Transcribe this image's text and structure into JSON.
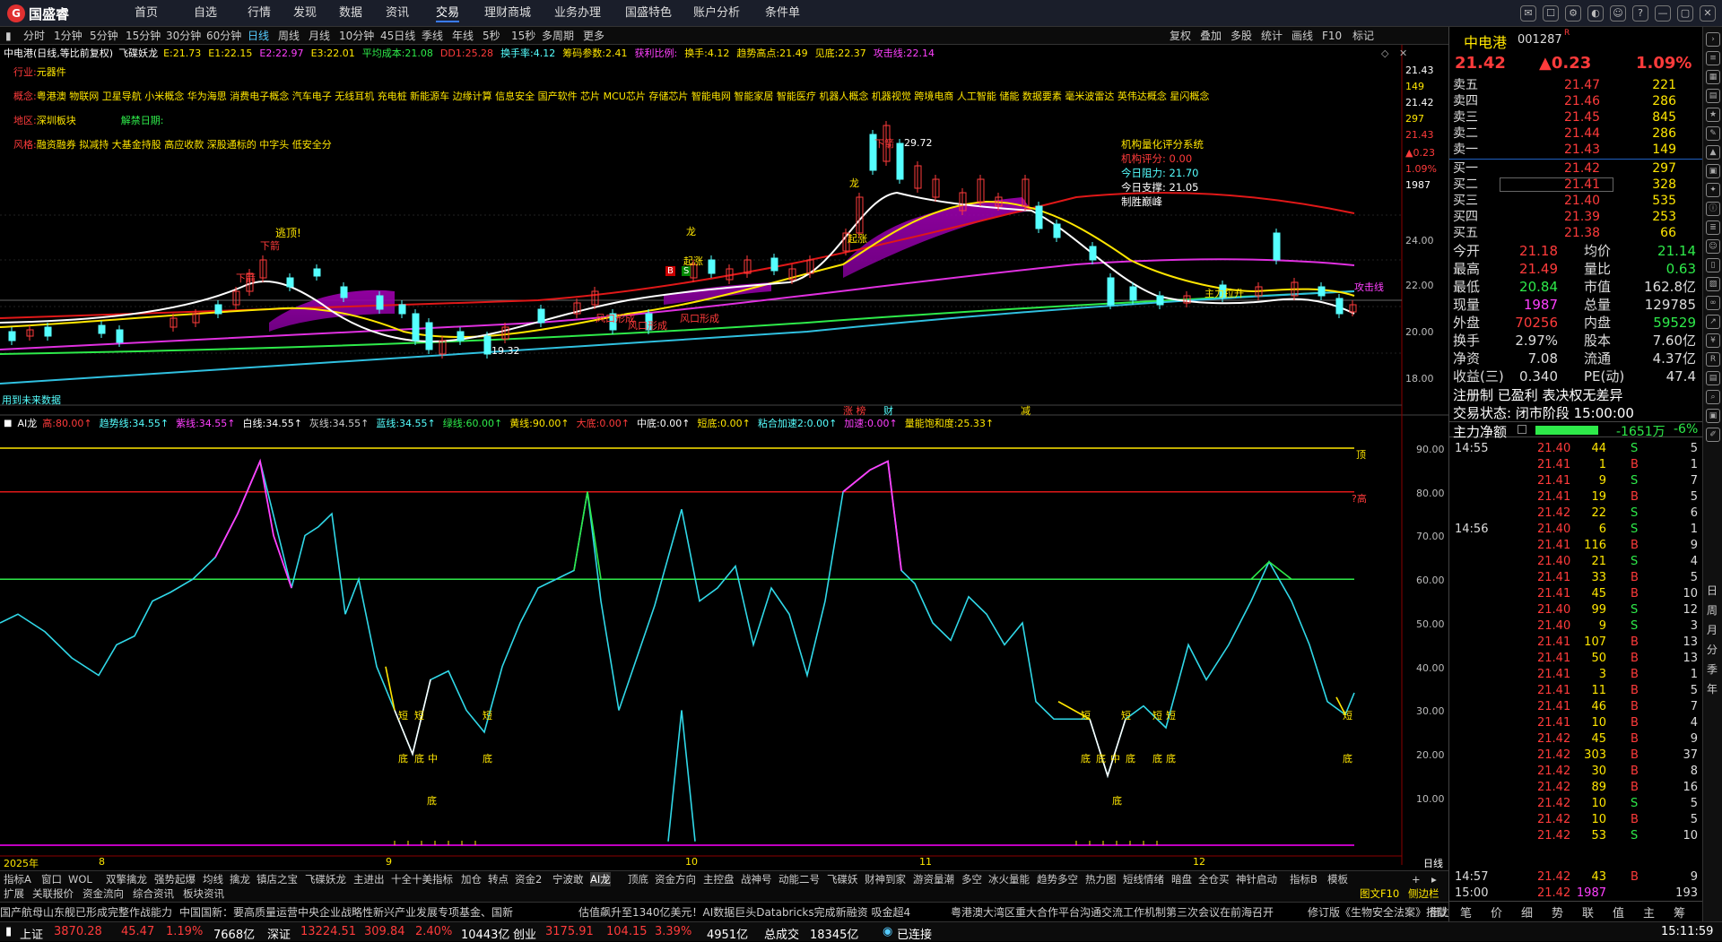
{
  "app": {
    "logo": "国盛睿",
    "logo_mark": "G"
  },
  "menu": [
    "首页",
    "自选",
    "行情",
    "发现",
    "数据",
    "资讯",
    "交易",
    "理财商城",
    "业务办理",
    "国盛特色",
    "账户分析",
    "条件单"
  ],
  "menu_active": 6,
  "window_buttons": [
    "消息",
    "消息2",
    "设置",
    "皮肤",
    "客服",
    "帮助",
    "最小化",
    "最大化",
    "关闭"
  ],
  "timeframes": [
    "分时",
    "1分钟",
    "5分钟",
    "15分钟",
    "30分钟",
    "60分钟",
    "日线",
    "周线",
    "月线",
    "10分钟",
    "45日线",
    "季线",
    "年线",
    "5秒",
    "15秒",
    "多周期",
    "更多"
  ],
  "tf_active": 6,
  "toolbar_right": [
    "复权",
    "叠加",
    "多股",
    "统计",
    "画线",
    "F10",
    "标记"
  ],
  "main_indicator": {
    "title": "中电港(日线,等比前复权)",
    "name": "飞碟妖龙",
    "items": [
      {
        "t": "E:21.73",
        "c": "#ffe600"
      },
      {
        "t": "E1:22.15",
        "c": "#ffe600"
      },
      {
        "t": "E2:22.97",
        "c": "#ff40ff"
      },
      {
        "t": "E3:22.01",
        "c": "#ffe600"
      },
      {
        "t": "平均成本:21.08",
        "c": "#2eea4a"
      },
      {
        "t": "DD1:25.28",
        "c": "#ff3b3b"
      },
      {
        "t": "换手率:4.12",
        "c": "#5ff"
      },
      {
        "t": "筹码参数:2.41",
        "c": "#ffe600"
      },
      {
        "t": "获利比例:",
        "c": "#ff40ff"
      },
      {
        "t": "换手:4.12",
        "c": "#ffe600"
      },
      {
        "t": "趋势高点:21.49",
        "c": "#ffe600"
      },
      {
        "t": "见底:22.37",
        "c": "#ffe600"
      },
      {
        "t": "攻击线:22.14",
        "c": "#ff40ff"
      }
    ]
  },
  "info": {
    "industry_label": "行业:",
    "industry": "元器件",
    "concept_label": "概念:",
    "concepts": "粤港澳 物联网 卫星导航 小米概念 华为海思 消费电子概念 汽车电子 无线耳机 充电桩 新能源车 边缘计算 信息安全 国产软件 芯片 MCU芯片 存储芯片 智能电网 智能家居 智能医疗 机器人概念 机器视觉 跨境电商 人工智能 储能 数据要素 毫米波雷达 英伟达概念 星闪概念",
    "region_label": "地区:",
    "region": "深圳板块",
    "unlock_label": "解禁日期:",
    "style_label": "风格:",
    "style": "融资融券 拟减持 大基金持股 高应收款 深股通标的 中字头 低安全分"
  },
  "rating": {
    "title": "机构量化评分系统",
    "score": "机构评分:  0.00",
    "resist": "今日阻力:  21.70",
    "support": "今日支撑:  21.05",
    "rule": "制胜巅峰"
  },
  "chart_labels": {
    "escape": "逃顶!",
    "down_arrow": "下箭",
    "up1": "龙",
    "up2": "龙",
    "high": "29.72",
    "low": "19.32",
    "wind1": "风口形成",
    "wind2": "风口形成",
    "wind3": "风口形成",
    "wind4": "风口形成",
    "rise": "起涨",
    "rise2": "起涨",
    "main_force": "主力拉升",
    "attack": "攻击线",
    "no_data": "用到未来数据",
    "limit": "涨 榜",
    "caibao": "财",
    "jian": "减",
    "b": "B",
    "s": "S"
  },
  "price_axis": [
    "21.43",
    "149",
    "21.42",
    "297",
    "21.43",
    "▲0.23",
    "1.09%",
    "1987",
    "24.00",
    "22.00",
    "20.00",
    "18.00"
  ],
  "ai_indicator": {
    "name": "AI龙",
    "items": [
      {
        "t": "高:80.00",
        "c": "#ff3b3b"
      },
      {
        "t": "趋势线:34.55",
        "c": "#5ff"
      },
      {
        "t": "紫线:34.55",
        "c": "#ff40ff"
      },
      {
        "t": "白线:34.55",
        "c": "#fff"
      },
      {
        "t": "灰线:34.55",
        "c": "#ccc"
      },
      {
        "t": "蓝线:34.55",
        "c": "#5ff"
      },
      {
        "t": "绿线:60.00",
        "c": "#2eea4a"
      },
      {
        "t": "黄线:90.00",
        "c": "#ffe600"
      },
      {
        "t": "大底:0.00",
        "c": "#ff3b3b"
      },
      {
        "t": "中底:0.00",
        "c": "#fff"
      },
      {
        "t": "短底:0.00",
        "c": "#ffe600"
      },
      {
        "t": "粘合加速2:0.00",
        "c": "#5ff"
      },
      {
        "t": "加速:0.00",
        "c": "#ff40ff"
      },
      {
        "t": "量能饱和度:25.33",
        "c": "#ffe600"
      }
    ],
    "axis": [
      "90.00",
      "80.00",
      "70.00",
      "60.00",
      "50.00",
      "40.00",
      "30.00",
      "20.00",
      "10.00"
    ],
    "top_label": "顶",
    "high_label": "?高",
    "bottom_label": "底",
    "short_label": "短",
    "mid_label": "中"
  },
  "date_axis": [
    "2025年",
    "8",
    "9",
    "10",
    "11",
    "12",
    "日线"
  ],
  "stock": {
    "name": "中电港",
    "code": "001287",
    "badge": "R",
    "price": "21.42",
    "change": "▲0.23",
    "pct": "1.09%"
  },
  "orderbook": {
    "sell": [
      {
        "l": "卖五",
        "p": "21.47",
        "v": "221"
      },
      {
        "l": "卖四",
        "p": "21.46",
        "v": "286"
      },
      {
        "l": "卖三",
        "p": "21.45",
        "v": "845"
      },
      {
        "l": "卖二",
        "p": "21.44",
        "v": "286"
      },
      {
        "l": "卖一",
        "p": "21.43",
        "v": "149"
      }
    ],
    "buy": [
      {
        "l": "买一",
        "p": "21.42",
        "v": "297"
      },
      {
        "l": "买二",
        "p": "21.41",
        "v": "328"
      },
      {
        "l": "买三",
        "p": "21.40",
        "v": "535"
      },
      {
        "l": "买四",
        "p": "21.39",
        "v": "253"
      },
      {
        "l": "买五",
        "p": "21.38",
        "v": "66"
      }
    ]
  },
  "stats": [
    {
      "a": "今开",
      "b": "21.18",
      "bc": "#ff3b3b",
      "c": "均价",
      "d": "21.14",
      "dc": "#2eea4a"
    },
    {
      "a": "最高",
      "b": "21.49",
      "bc": "#ff3b3b",
      "c": "量比",
      "d": "0.63",
      "dc": "#2eea4a"
    },
    {
      "a": "最低",
      "b": "20.84",
      "bc": "#2eea4a",
      "c": "市值",
      "d": "162.8亿",
      "dc": "#ddd"
    },
    {
      "a": "现量",
      "b": "1987",
      "bc": "#ff40ff",
      "c": "总量",
      "d": "129785",
      "dc": "#ddd"
    },
    {
      "a": "外盘",
      "b": "70256",
      "bc": "#ff3b3b",
      "c": "内盘",
      "d": "59529",
      "dc": "#2eea4a"
    },
    {
      "a": "换手",
      "b": "2.97%",
      "bc": "#ddd",
      "c": "股本",
      "d": "7.60亿",
      "dc": "#ddd"
    },
    {
      "a": "净资",
      "b": "7.08",
      "bc": "#ddd",
      "c": "流通",
      "d": "4.37亿",
      "dc": "#ddd"
    },
    {
      "a": "收益(三)",
      "b": "0.340",
      "bc": "#ddd",
      "c": "PE(动)",
      "d": "47.4",
      "dc": "#ddd"
    }
  ],
  "reg": "注册制 已盈利 表决权无差异",
  "trade_status": "交易状态: 闭市阶段 15:00:00",
  "main_flow": {
    "label": "主力净额",
    "value": "-1651万",
    "pct": "-6%"
  },
  "ticks": [
    {
      "t": "14:55",
      "p": "21.40",
      "v": "44",
      "d": "S",
      "n": "5"
    },
    {
      "t": "",
      "p": "21.41",
      "v": "1",
      "d": "B",
      "n": "1"
    },
    {
      "t": "",
      "p": "21.41",
      "v": "9",
      "d": "S",
      "n": "7"
    },
    {
      "t": "",
      "p": "21.41",
      "v": "19",
      "d": "B",
      "n": "5"
    },
    {
      "t": "",
      "p": "21.42",
      "v": "22",
      "d": "S",
      "n": "6"
    },
    {
      "t": "14:56",
      "p": "21.40",
      "v": "6",
      "d": "S",
      "n": "1"
    },
    {
      "t": "",
      "p": "21.41",
      "v": "116",
      "d": "B",
      "n": "9"
    },
    {
      "t": "",
      "p": "21.40",
      "v": "21",
      "d": "S",
      "n": "4"
    },
    {
      "t": "",
      "p": "21.41",
      "v": "33",
      "d": "B",
      "n": "5"
    },
    {
      "t": "",
      "p": "21.41",
      "v": "45",
      "d": "B",
      "n": "10"
    },
    {
      "t": "",
      "p": "21.40",
      "v": "99",
      "d": "S",
      "n": "12"
    },
    {
      "t": "",
      "p": "21.40",
      "v": "9",
      "d": "S",
      "n": "3"
    },
    {
      "t": "",
      "p": "21.41",
      "v": "107",
      "d": "B",
      "n": "13"
    },
    {
      "t": "",
      "p": "21.41",
      "v": "50",
      "d": "B",
      "n": "13"
    },
    {
      "t": "",
      "p": "21.41",
      "v": "3",
      "d": "B",
      "n": "1"
    },
    {
      "t": "",
      "p": "21.41",
      "v": "11",
      "d": "B",
      "n": "5"
    },
    {
      "t": "",
      "p": "21.41",
      "v": "46",
      "d": "B",
      "n": "7"
    },
    {
      "t": "",
      "p": "21.41",
      "v": "10",
      "d": "B",
      "n": "4"
    },
    {
      "t": "",
      "p": "21.42",
      "v": "45",
      "d": "B",
      "n": "9"
    },
    {
      "t": "",
      "p": "21.42",
      "v": "303",
      "d": "B",
      "n": "37"
    },
    {
      "t": "",
      "p": "21.42",
      "v": "30",
      "d": "B",
      "n": "8"
    },
    {
      "t": "",
      "p": "21.42",
      "v": "89",
      "d": "B",
      "n": "16"
    },
    {
      "t": "",
      "p": "21.42",
      "v": "10",
      "d": "S",
      "n": "5"
    },
    {
      "t": "",
      "p": "21.42",
      "v": "10",
      "d": "B",
      "n": "5"
    },
    {
      "t": "",
      "p": "21.42",
      "v": "53",
      "d": "S",
      "n": "10"
    },
    {
      "t": "14:57",
      "p": "21.42",
      "v": "43",
      "d": "B",
      "n": "9"
    },
    {
      "t": "15:00",
      "p": "21.42",
      "v": "1987",
      "d": "",
      "n": "193"
    }
  ],
  "rp_tabs": [
    "笔",
    "价",
    "细",
    "势",
    "联",
    "值",
    "主",
    "筹"
  ],
  "tabs": [
    "指标A",
    "窗口",
    "WOL",
    "双擎擒龙",
    "强势起爆",
    "均线",
    "擒龙",
    "镇店之宝",
    "飞碟妖龙",
    "主进出",
    "十全十美指标",
    "加仓",
    "转点",
    "资金2",
    "宁波敢",
    "AI龙",
    "顶底",
    "资金方向",
    "主控盘",
    "战神号",
    "动能二号",
    "飞碟妖",
    "财神到家",
    "游资量潮",
    "多空",
    "冰火量能",
    "趋势多空",
    "热力图",
    "短线情绪",
    "暗盘",
    "全仓买",
    "神针启动",
    "指标B",
    "模板"
  ],
  "tab_active": 15,
  "tabs2": [
    "扩展",
    "关联报价",
    "资金流向",
    "综合资讯",
    "板块资讯"
  ],
  "tabs2_right": [
    "图文F10",
    "侧边栏"
  ],
  "news": [
    "国产航母山东舰已形成完整作战能力",
    "中国国新：要高质量运营中央企业战略性新兴产业发展专项基金、国新",
    "估值飙升至1340亿美元！AI数据巨头Databricks完成新融资  吸金超4",
    "粤港澳大湾区重大合作平台沟通交流工作机制第三次会议在前海召开",
    "修订版《生物安全法案》搭载美NDAA即将在美参议院表决 仍未点名具",
    "借力"
  ],
  "status": {
    "sh": {
      "label": "上证",
      "v": "3870.28",
      "c": "45.47",
      "p": "1.19%",
      "a": "7668亿"
    },
    "sz": {
      "label": "深证",
      "v": "13224.51",
      "c": "309.84",
      "p": "2.40%",
      "a": "10443亿"
    },
    "cy": {
      "label": "创业",
      "v": "3175.91",
      "c": "104.15",
      "p": "3.39%",
      "a": "4951亿"
    },
    "total_label": "总成交",
    "total": "18345亿",
    "conn": "已连接",
    "time": "15:11:59"
  },
  "right_sidebar": [
    "日",
    "周",
    "月",
    "分",
    "季",
    "年"
  ],
  "colors": {
    "up": "#ff3b3b",
    "down": "#2eea4a",
    "bg": "#000000"
  }
}
